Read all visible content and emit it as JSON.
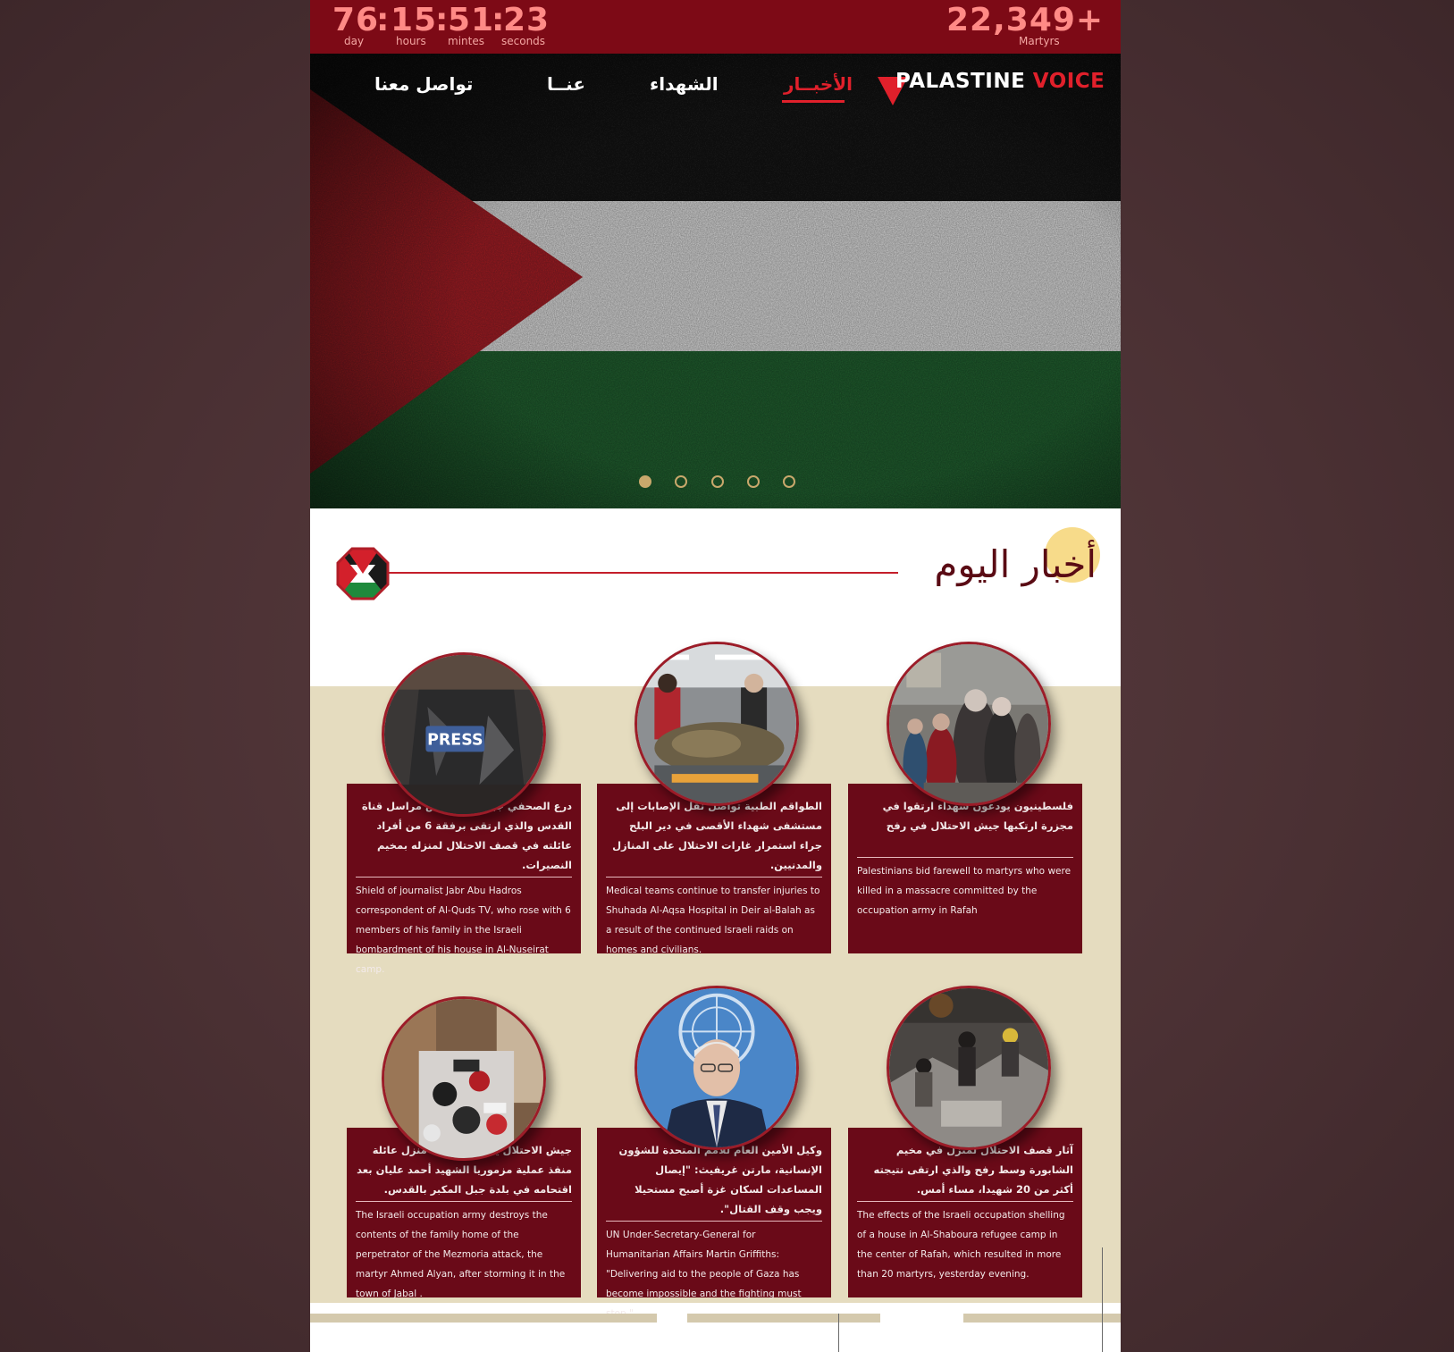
{
  "counter": {
    "days": "76",
    "hours": "15",
    "minutes": "51",
    "seconds": "23",
    "sep": ":",
    "day_label": "day",
    "hours_label": "hours",
    "minutes_label": "mintes",
    "seconds_label": "seconds"
  },
  "martyrs": {
    "count": "22,349+",
    "label": "Martyrs"
  },
  "brand": {
    "part1": "PALASTINE",
    "part2": "VOICE"
  },
  "nav": {
    "news": "الأخبــار",
    "martyrs": "الشهداء",
    "about": "عنــا",
    "contact": "تواصل معنا"
  },
  "slider": {
    "count": 5,
    "active_index": 0
  },
  "section": {
    "title": "أخبار اليوم"
  },
  "colors": {
    "topbar": "#7d0a16",
    "accent": "#e0202b",
    "card": "#6a0a18",
    "section_bg": "#e5dcbf"
  },
  "cards": [
    {
      "ar": "فلسطينيون يودعون شهداء ارتقوا في مجزرة ارتكبها جيش الاحتلال في رفح",
      "en": "Palestinians bid farewell to martyrs who were killed in a massacre committed by the occupation army in Rafah",
      "image": "mourners-photo"
    },
    {
      "ar": "الطواقم الطبية تواصل نقل الإصابات إلى مستشفى شهداء الأقصى في دير البلح جراء استمرار غارات الاحتلال على المنازل والمدنيين.",
      "en": "Medical teams continue to transfer injuries to Shuhada Al-Aqsa Hospital in Deir al-Balah as a result of the continued Israeli raids on homes and civilians.",
      "image": "hospital-photo"
    },
    {
      "ar": "درع الصحفي جبر أبو هدروس مراسل قناة القدس والذي ارتقى برفقة 6 من أفراد عائلته في قصف الاحتلال لمنزله بمخيم النصيرات.",
      "en": "Shield of journalist Jabr Abu Hadros correspondent of Al-Quds TV, who rose with 6 members of his family in the Israeli bombardment of his house in Al-Nuseirat camp.",
      "image": "press-vest-photo",
      "image_text": "PRESS"
    },
    {
      "ar": "آثار قصف الاحتلال لمنزل في مخيم الشابورة وسط رفح والذي ارتقى نتيجته أكثر من 20 شهيدا، مساء أمس.",
      "en": "The effects of the Israeli occupation shelling of a house in Al-Shaboura refugee camp in the center of Rafah, which resulted in more than 20 martyrs, yesterday evening.",
      "image": "rubble-photo"
    },
    {
      "ar": "وكيل الأمين العام للأمم المتحدة للشؤون الإنسانية، مارتن غريفيث: \"إيصال المساعدات لسكان غزة أصبح مستحيلا ويجب وقف القتال\".",
      "en": "UN Under-Secretary-General for Humanitarian Affairs Martin Griffiths: \"Delivering aid to the people of Gaza has become impossible and the fighting must stop.\"",
      "image": "un-official-photo"
    },
    {
      "ar": "جيش الاحتلال يدمر محتويات منزل عائلة منفذ عملية مزموريا الشهيد أحمد عليان بعد اقتحامه في بلدة جبل المكبر بالقدس.",
      "en": "The Israeli occupation army destroys the contents of the family home of the perpetrator of the Mezmoria attack, the martyr Ahmed Alyan, after storming it in the town of Jabal .",
      "image": "destroyed-home-photo"
    }
  ]
}
